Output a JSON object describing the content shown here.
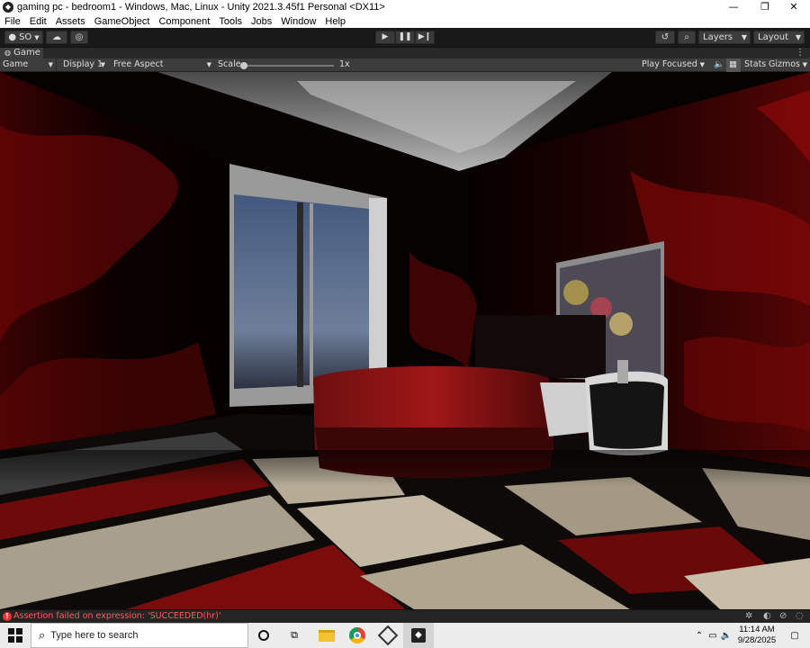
{
  "window": {
    "title": "gaming pc - bedroom1 - Windows, Mac, Linux - Unity 2021.3.45f1 Personal <DX11>",
    "controls": [
      "—",
      "❐",
      "✕"
    ]
  },
  "menu": [
    "File",
    "Edit",
    "Assets",
    "GameObject",
    "Component",
    "Tools",
    "Jobs",
    "Window",
    "Help"
  ],
  "toolbar": {
    "account_label": "SO",
    "layers_label": "Layers",
    "layout_label": "Layout"
  },
  "tab": {
    "label": "Game"
  },
  "gamebar": {
    "mode": "Game",
    "display": "Display 1",
    "aspect": "Free Aspect",
    "scale_label": "Scale",
    "scale_value": "1x",
    "scale_fraction": 0,
    "play_focused": "Play Focused",
    "stats": "Stats",
    "gizmos": "Gizmos"
  },
  "status": {
    "message": "Assertion failed on expression: 'SUCCEEDED(hr)'",
    "color": "#ff5b5b"
  },
  "taskbar": {
    "search_placeholder": "Type here to search",
    "time": "11:14 AM",
    "date": "9/28/2025"
  },
  "colors": {
    "wall_red": "#8b0a0a",
    "floor_beige": "#b8ac98",
    "floor_red": "#7a0c0c",
    "editor_bg": "#191919"
  }
}
